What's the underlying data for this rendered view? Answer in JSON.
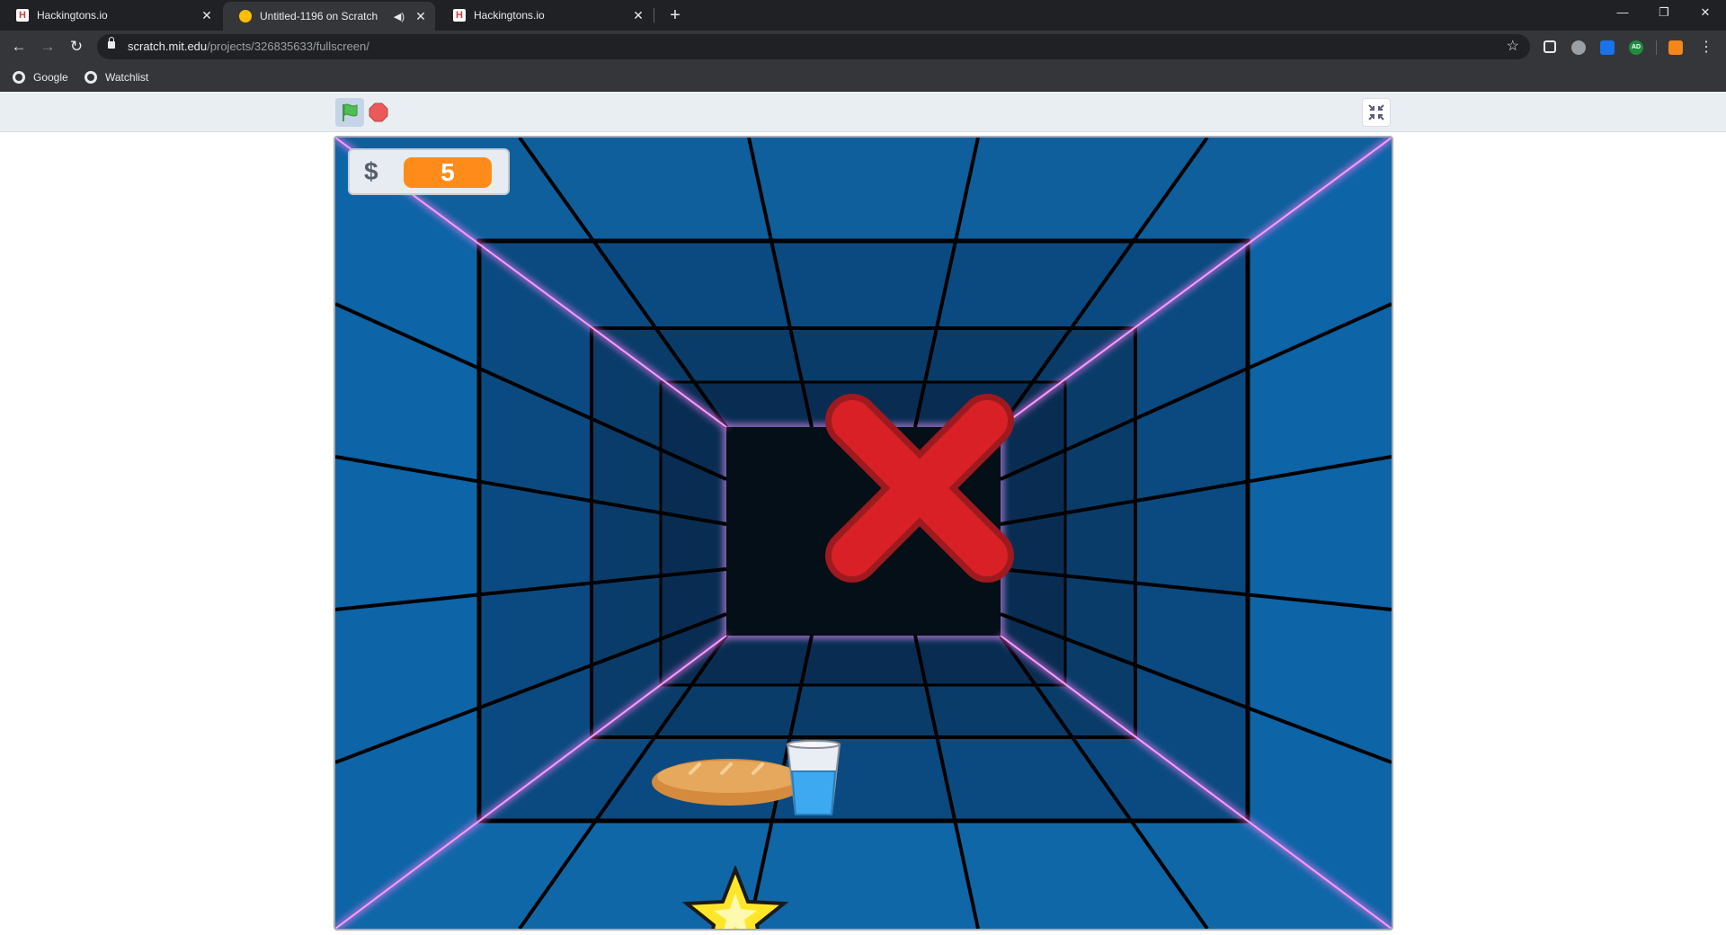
{
  "browser": {
    "tabs": [
      {
        "title": "Hackingtons.io",
        "active": false
      },
      {
        "title": "Untitled-1196 on Scratch",
        "active": true,
        "audio": true
      },
      {
        "title": "Hackingtons.io",
        "active": false
      }
    ],
    "address": {
      "host": "scratch.mit.edu",
      "path": "/projects/326835633/fullscreen/"
    },
    "bookmarks": [
      "Google",
      "Watchlist"
    ],
    "extensions": [
      {
        "icon": "drive-icon"
      },
      {
        "icon": "brain-icon"
      },
      {
        "icon": "translate-icon",
        "color": "#1a73e8"
      },
      {
        "icon": "ad-blocker-icon",
        "label": "AD",
        "color": "#1e8e3e"
      },
      {
        "icon": "fox-icon",
        "color": "#f6851b"
      }
    ]
  },
  "scratch": {
    "controls": [
      "green-flag",
      "stop",
      "exit-fullscreen"
    ],
    "monitor": {
      "label": "$",
      "value": "5"
    },
    "colors": {
      "tunnel": "#0c5a96",
      "neon": "#ff7bff",
      "cross": "#d92027",
      "monitor_value": "#ff8c1a"
    },
    "sprites": [
      "red-x",
      "bread",
      "water-glass",
      "star"
    ]
  }
}
